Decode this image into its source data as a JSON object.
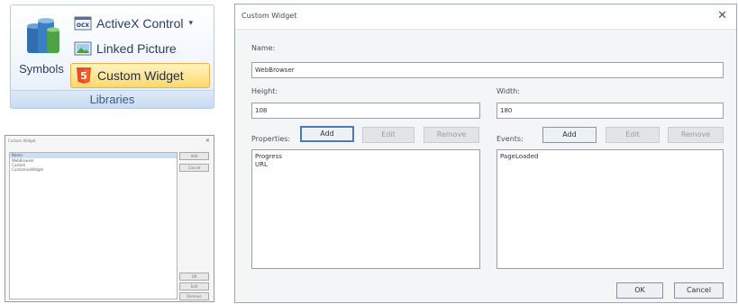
{
  "ribbon": {
    "symbols_label": "Symbols",
    "items": [
      {
        "label": "ActiveX Control",
        "icon": "ocx-icon",
        "icon_text": "OCX",
        "dropdown": "▾"
      },
      {
        "label": "Linked Picture",
        "icon": "linked-picture-icon"
      },
      {
        "label": "Custom Widget",
        "icon": "html5-icon",
        "icon_text": "5"
      }
    ],
    "group_label": "Libraries",
    "accent": "#ffd86b"
  },
  "mini_dialog": {
    "title": "Custom Widget",
    "close": "✕",
    "list_header": "Name",
    "items": [
      "WebBrowser",
      "Custom",
      "CustomizeWidget"
    ],
    "buttons": [
      "Add",
      "Cancel",
      "OK",
      "Edit",
      "Remove"
    ]
  },
  "dialog": {
    "title": "Custom Widget",
    "close": "✕",
    "name_label": "Name:",
    "name_value": "WebBrowser",
    "height_label": "Height:",
    "height_value": "108",
    "width_label": "Width:",
    "width_value": "180",
    "properties_label": "Properties:",
    "events_label": "Events:",
    "add_label": "Add",
    "edit_label": "Edit",
    "remove_label": "Remove",
    "properties": [
      "Progress",
      "URL"
    ],
    "events": [
      "PageLoaded"
    ],
    "ok_label": "OK",
    "cancel_label": "Cancel"
  }
}
